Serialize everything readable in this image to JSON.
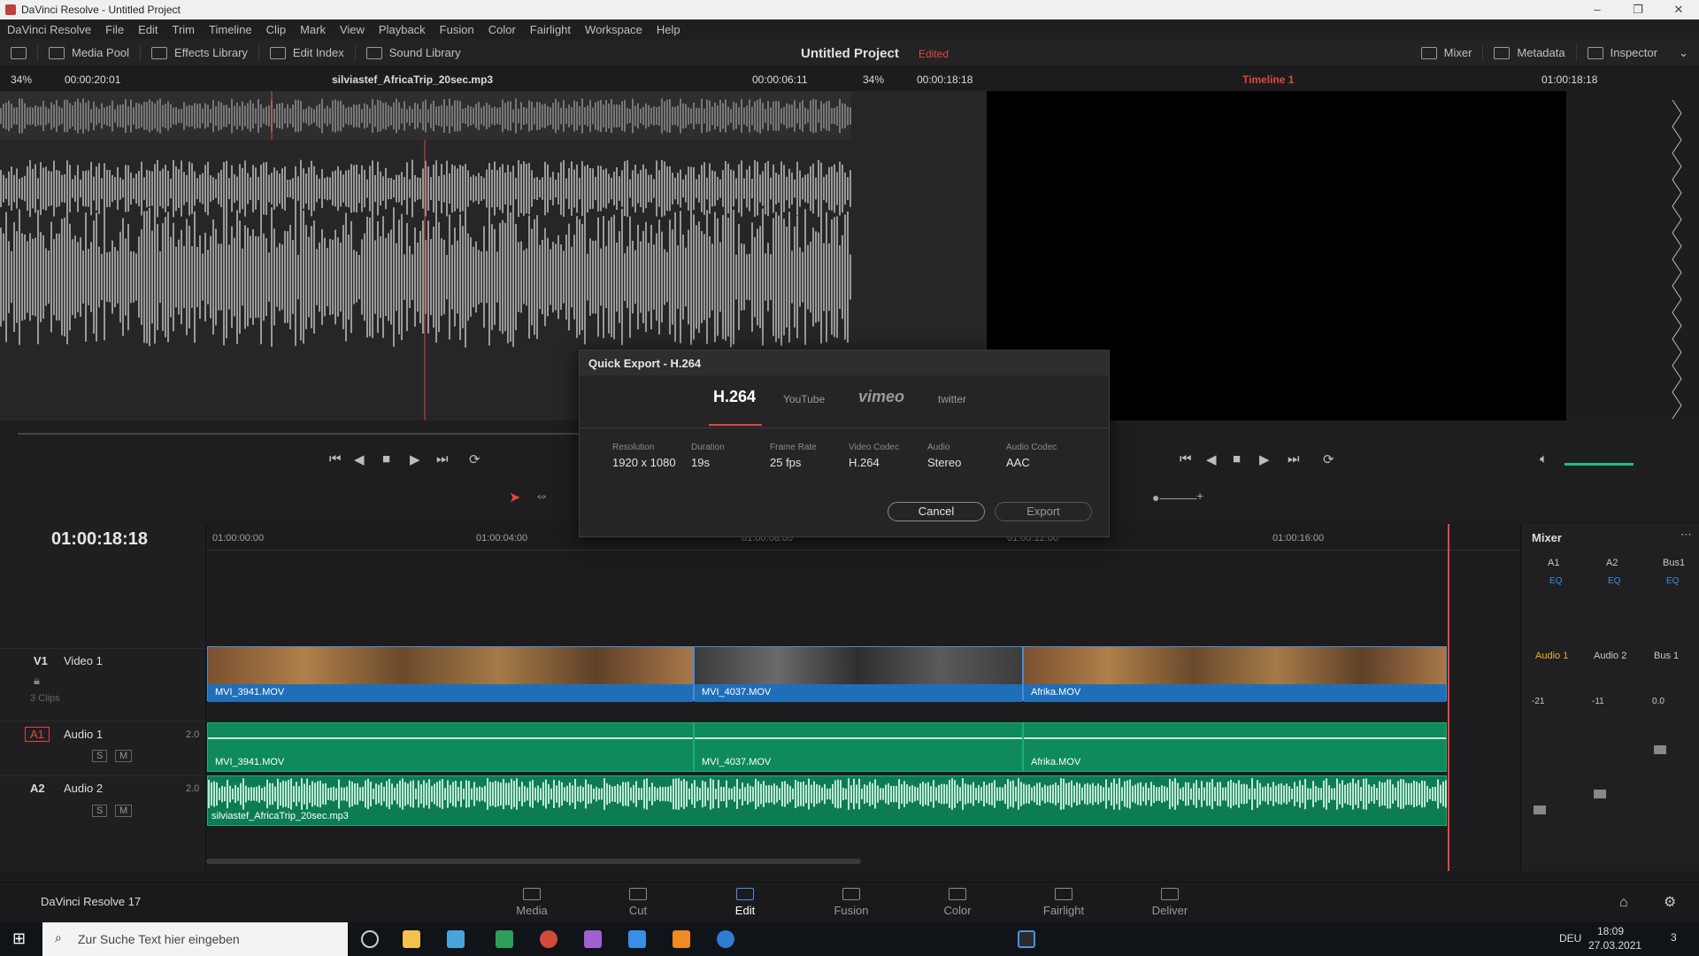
{
  "window": {
    "title": "DaVinci Resolve - Untitled Project"
  },
  "menu": [
    "DaVinci Resolve",
    "File",
    "Edit",
    "Trim",
    "Timeline",
    "Clip",
    "Mark",
    "View",
    "Playback",
    "Fusion",
    "Color",
    "Fairlight",
    "Workspace",
    "Help"
  ],
  "toolbar": {
    "media_pool": "Media Pool",
    "effects_library": "Effects Library",
    "edit_index": "Edit Index",
    "sound_library": "Sound Library",
    "project_title": "Untitled Project",
    "project_state": "Edited",
    "mixer": "Mixer",
    "metadata": "Metadata",
    "inspector": "Inspector"
  },
  "source_viewer": {
    "zoom": "34%",
    "duration": "00:00:20:01",
    "clip_name": "silviastef_AfricaTrip_20sec.mp3",
    "timecode": "00:00:06:11"
  },
  "program_viewer": {
    "zoom": "34%",
    "duration": "00:00:18:18",
    "timeline_name": "Timeline 1",
    "timecode": "01:00:18:18"
  },
  "dialog": {
    "title": "Quick Export - H.264",
    "tabs": [
      "H.264",
      "YouTube",
      "vimeo",
      "twitter"
    ],
    "specs": [
      {
        "label": "Resolution",
        "value": "1920 x 1080"
      },
      {
        "label": "Duration",
        "value": "19s"
      },
      {
        "label": "Frame Rate",
        "value": "25 fps"
      },
      {
        "label": "Video Codec",
        "value": "H.264"
      },
      {
        "label": "Audio",
        "value": "Stereo"
      },
      {
        "label": "Audio Codec",
        "value": "AAC"
      }
    ],
    "cancel": "Cancel",
    "export": "Export"
  },
  "timeline": {
    "timecode": "01:00:18:18",
    "ruler": [
      "01:00:00:00",
      "01:00:04:00",
      "01:00:08:00",
      "01:00:12:00",
      "01:00:16:00"
    ],
    "tracks": {
      "v1": {
        "id": "V1",
        "name": "Video 1",
        "clips_count": "3 Clips"
      },
      "a1": {
        "id": "A1",
        "name": "Audio 1",
        "channels": "2.0"
      },
      "a2": {
        "id": "A2",
        "name": "Audio 2",
        "channels": "2.0"
      }
    },
    "video_clips": [
      "MVI_3941.MOV",
      "MVI_4037.MOV",
      "Afrika.MOV"
    ],
    "audio_clips": [
      "MVI_3941.MOV",
      "MVI_4037.MOV",
      "Afrika.MOV"
    ],
    "music_clip": "silviastef_AfricaTrip_20sec.mp3"
  },
  "mixer": {
    "title": "Mixer",
    "columns": [
      "A1",
      "A2",
      "Bus1"
    ],
    "eq": "EQ",
    "channel_names": [
      "Audio 1",
      "Audio 2",
      "Bus 1"
    ],
    "levels": [
      "-21",
      "-11",
      "0.0"
    ],
    "scale": [
      "-5",
      "-10",
      "-15",
      "-20",
      "-30",
      "-40",
      "-50"
    ]
  },
  "pages": [
    "Media",
    "Cut",
    "Edit",
    "Fusion",
    "Color",
    "Fairlight",
    "Deliver"
  ],
  "active_page": "Edit",
  "brand": "DaVinci Resolve 17",
  "taskbar": {
    "search_placeholder": "Zur Suche Text hier eingeben",
    "lang": "DEU",
    "time": "18:09",
    "date": "27.03.2021",
    "notifications": "3"
  },
  "colors": {
    "accent": "#e2473b",
    "video_clip": "#1f6fb8",
    "audio_clip": "#0e8a5c"
  }
}
